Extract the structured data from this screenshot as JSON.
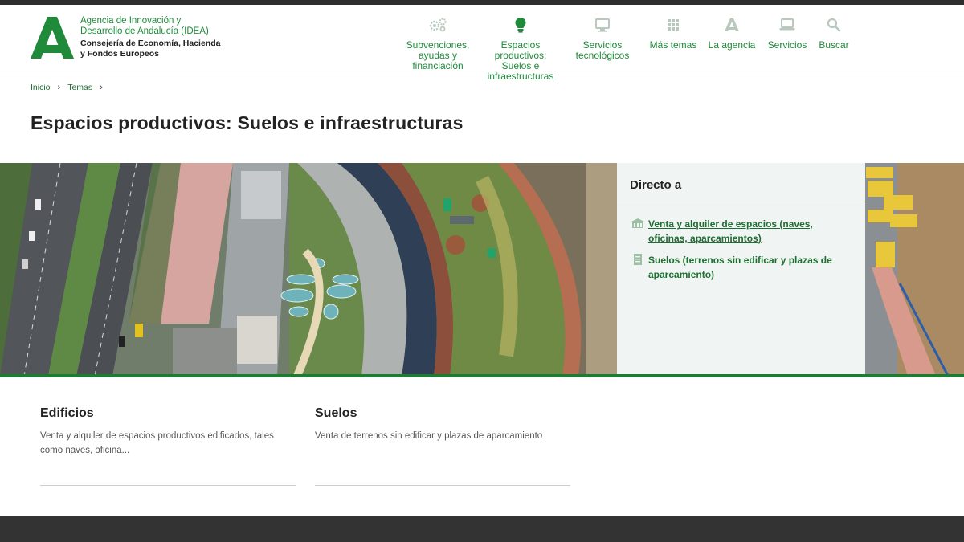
{
  "header": {
    "agency_name": "Agencia de Innovación y Desarrollo de Andalucía (IDEA)",
    "consejeria": "Consejería de Economía, Hacienda y Fondos Europeos"
  },
  "nav": {
    "items": [
      {
        "label": "Subvenciones, ayudas y financiación",
        "icon": "gears-icon"
      },
      {
        "label": "Espacios productivos: Suelos e infraestructuras",
        "icon": "lightbulb-icon"
      },
      {
        "label": "Servicios tecnológicos",
        "icon": "monitor-icon"
      },
      {
        "label": "Más temas",
        "icon": "grid-icon"
      },
      {
        "label": "La agencia",
        "icon": "andalucia-a-icon"
      },
      {
        "label": "Servicios",
        "icon": "laptop-icon"
      },
      {
        "label": "Buscar",
        "icon": "search-icon"
      }
    ]
  },
  "breadcrumb": {
    "items": [
      "Inicio",
      "Temas"
    ]
  },
  "page": {
    "title": "Espacios productivos: Suelos e infraestructuras"
  },
  "direct": {
    "title": "Directo a",
    "links": [
      {
        "label": "Venta y alquiler de espacios (naves, oficinas, aparcamientos)",
        "icon": "building-icon"
      },
      {
        "label": "Suelos (terrenos sin edificar y plazas de aparcamiento)",
        "icon": "document-icon"
      }
    ]
  },
  "cards": [
    {
      "title": "Edificios",
      "description": "Venta y alquiler de espacios productivos edificados, tales como naves, oficina..."
    },
    {
      "title": "Suelos",
      "description": "Venta de terrenos sin edificar y plazas de aparcamiento"
    }
  ],
  "colors": {
    "brand_green": "#1e8a3a",
    "link_green": "#1e6e32",
    "footer": "#333333"
  }
}
